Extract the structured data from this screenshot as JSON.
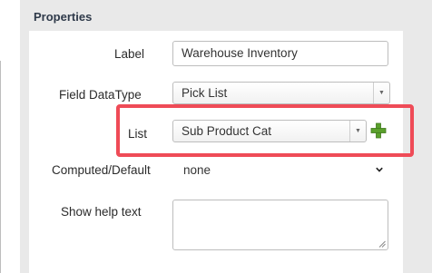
{
  "section": {
    "title": "Properties"
  },
  "fields": {
    "label": {
      "label": "Label",
      "value": "Warehouse Inventory"
    },
    "datatype": {
      "label": "Field DataType",
      "value": "Pick List"
    },
    "list": {
      "label": "List",
      "value": "Sub Product Cat"
    },
    "computed": {
      "label": "Computed/Default",
      "value": "none"
    },
    "help": {
      "label": "Show help text",
      "value": ""
    }
  },
  "icons": {
    "add": "plus-icon",
    "dropdown": "triangle-down-icon",
    "chevron": "chevron-down-icon",
    "resize": "resize-grip-icon"
  },
  "colors": {
    "highlight": "#ef4b57",
    "plus": "#5aa02c",
    "title": "#2f3a4a"
  }
}
